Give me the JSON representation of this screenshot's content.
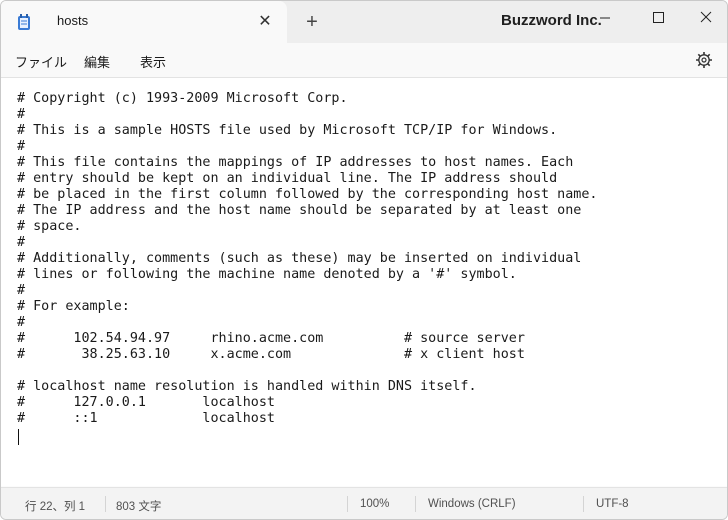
{
  "tab": {
    "title": "hosts",
    "close_glyph": "✕",
    "new_tab_glyph": "+"
  },
  "app_name": "Buzzword Inc.",
  "menu": [
    "ファイル",
    "編集",
    "表示"
  ],
  "editor_lines": [
    "# Copyright (c) 1993-2009 Microsoft Corp.",
    "#",
    "# This is a sample HOSTS file used by Microsoft TCP/IP for Windows.",
    "#",
    "# This file contains the mappings of IP addresses to host names. Each",
    "# entry should be kept on an individual line. The IP address should",
    "# be placed in the first column followed by the corresponding host name.",
    "# The IP address and the host name should be separated by at least one",
    "# space.",
    "#",
    "# Additionally, comments (such as these) may be inserted on individual",
    "# lines or following the machine name denoted by a '#' symbol.",
    "#",
    "# For example:",
    "#",
    "#      102.54.94.97     rhino.acme.com          # source server",
    "#       38.25.63.10     x.acme.com              # x client host",
    "",
    "# localhost name resolution is handled within DNS itself.",
    "#      127.0.0.1       localhost",
    "#      ::1             localhost",
    ""
  ],
  "status": {
    "position": "行 22、列 1",
    "char_count": "803 文字",
    "zoom": "100%",
    "line_ending": "Windows (CRLF)",
    "encoding": "UTF-8"
  },
  "colors": {
    "titlebar": "#eeeeee",
    "tab": "#f9f9f9",
    "editor": "#ffffff",
    "statusbar": "#f3f3f3"
  }
}
